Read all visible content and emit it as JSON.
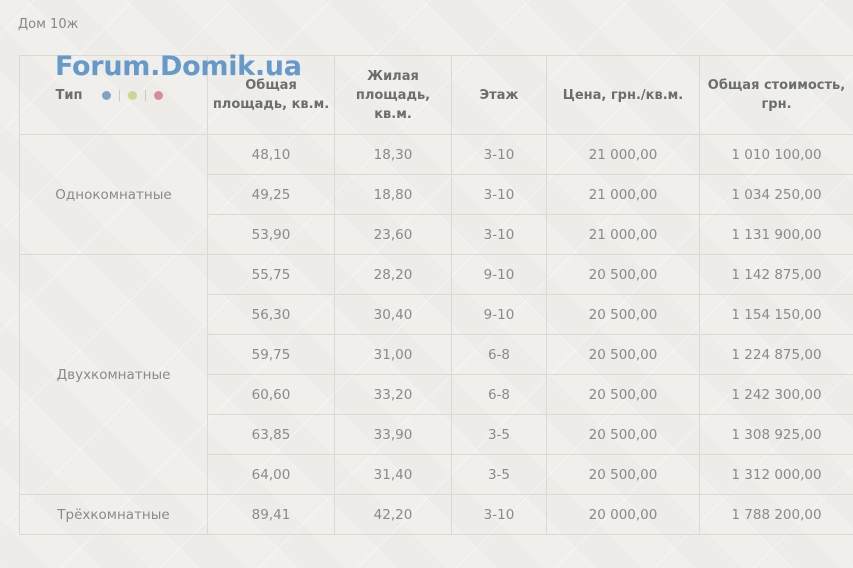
{
  "caption": "Дом 10ж",
  "watermark": "Forum.Domik.ua",
  "dot_colors": [
    "#7ea3c9",
    "#cfd48f",
    "#d98b9b"
  ],
  "headers": {
    "type": "Тип",
    "total_area": "Общая площадь, кв.м.",
    "living_area": "Жилая площадь, кв.м.",
    "floor": "Этаж",
    "price": "Цена, грн./кв.м.",
    "total_cost": "Общая стоимость, грн."
  },
  "groups": [
    {
      "type": "Однокомнатные",
      "rows": [
        {
          "total_area": "48,10",
          "living_area": "18,30",
          "floor": "3-10",
          "price": "21 000,00",
          "total_cost": "1 010 100,00"
        },
        {
          "total_area": "49,25",
          "living_area": "18,80",
          "floor": "3-10",
          "price": "21 000,00",
          "total_cost": "1 034 250,00"
        },
        {
          "total_area": "53,90",
          "living_area": "23,60",
          "floor": "3-10",
          "price": "21 000,00",
          "total_cost": "1 131 900,00"
        }
      ]
    },
    {
      "type": "Двухкомнатные",
      "rows": [
        {
          "total_area": "55,75",
          "living_area": "28,20",
          "floor": "9-10",
          "price": "20 500,00",
          "total_cost": "1 142 875,00"
        },
        {
          "total_area": "56,30",
          "living_area": "30,40",
          "floor": "9-10",
          "price": "20 500,00",
          "total_cost": "1 154 150,00"
        },
        {
          "total_area": "59,75",
          "living_area": "31,00",
          "floor": "6-8",
          "price": "20 500,00",
          "total_cost": "1 224 875,00"
        },
        {
          "total_area": "60,60",
          "living_area": "33,20",
          "floor": "6-8",
          "price": "20 500,00",
          "total_cost": "1 242 300,00"
        },
        {
          "total_area": "63,85",
          "living_area": "33,90",
          "floor": "3-5",
          "price": "20 500,00",
          "total_cost": "1 308 925,00"
        },
        {
          "total_area": "64,00",
          "living_area": "31,40",
          "floor": "3-5",
          "price": "20 500,00",
          "total_cost": "1 312 000,00"
        }
      ]
    },
    {
      "type": "Трёхкомнатные",
      "rows": [
        {
          "total_area": "89,41",
          "living_area": "42,20",
          "floor": "3-10",
          "price": "20 000,00",
          "total_cost": "1 788 200,00"
        }
      ]
    }
  ]
}
